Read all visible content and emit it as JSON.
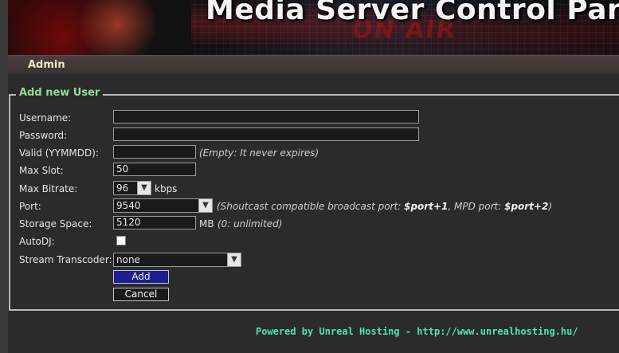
{
  "banner": {
    "title": "Media Server Control Panel",
    "background_text": "ON AIR"
  },
  "nav": {
    "admin": "Admin"
  },
  "form": {
    "legend": "Add new User",
    "username": {
      "label": "Username:",
      "value": ""
    },
    "password": {
      "label": "Password:",
      "value": ""
    },
    "valid": {
      "label": "Valid (YYMMDD):",
      "value": "",
      "hint": "(Empty: It never expires)"
    },
    "max_slot": {
      "label": "Max Slot:",
      "value": "50"
    },
    "max_bitrate": {
      "label": "Max Bitrate:",
      "value": "96",
      "unit": "kbps"
    },
    "port": {
      "label": "Port:",
      "value": "9540",
      "hint_prefix": "(Shoutcast compatible broadcast port: ",
      "hint_var1": "$port+1",
      "hint_mid": ", MPD port: ",
      "hint_var2": "$port+2",
      "hint_suffix": ")"
    },
    "storage": {
      "label": "Storage Space:",
      "value": "5120",
      "unit": "MB",
      "hint": "(0: unlimited)"
    },
    "autodj": {
      "label": "AutoDJ:",
      "checked": false
    },
    "transcoder": {
      "label": "Stream Transcoder:",
      "value": "none"
    },
    "add_label": "Add",
    "cancel_label": "Cancel"
  },
  "footer": {
    "text": "Powered by Unreal Hosting - http://www.unrealhosting.hu/"
  },
  "colors": {
    "legend": "#8fdc9a",
    "footer": "#4fe3b0",
    "add_button": "#1b1f8f",
    "nav_text": "#f0e6c0"
  }
}
